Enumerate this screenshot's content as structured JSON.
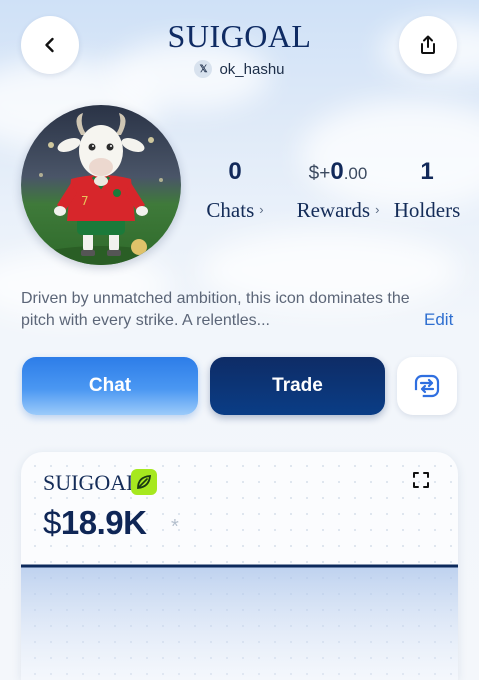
{
  "header": {
    "title": "SUIGOAL",
    "handle": "ok_hashu",
    "handle_platform_icon": "x-logo-icon",
    "back_icon": "chevron-left-icon",
    "share_icon": "share-icon"
  },
  "profile": {
    "avatar_icon": "goat-mascot-avatar",
    "stats": {
      "chats": {
        "value": "0",
        "label": "Chats"
      },
      "rewards": {
        "prefix": "$+",
        "value_main": "0",
        "value_cents": ".00",
        "label": "Rewards"
      },
      "holders": {
        "value": "1",
        "label": "Holders"
      }
    },
    "description": "Driven by unmatched ambition, this icon dominates the pitch with every strike. A relentles...",
    "edit_label": "Edit"
  },
  "actions": {
    "chat_label": "Chat",
    "trade_label": "Trade",
    "swap_icon": "swap-icon"
  },
  "card": {
    "name": "SUIGOAL",
    "badge_icon": "leaf-icon",
    "expand_icon": "expand-icon",
    "currency": "$",
    "price": "18.9K",
    "asterisk": "*"
  },
  "colors": {
    "primary_dark": "#0e2c66",
    "primary_light": "#2d7de8",
    "badge_green": "#a6e81f",
    "link_blue": "#2f6fd0"
  }
}
